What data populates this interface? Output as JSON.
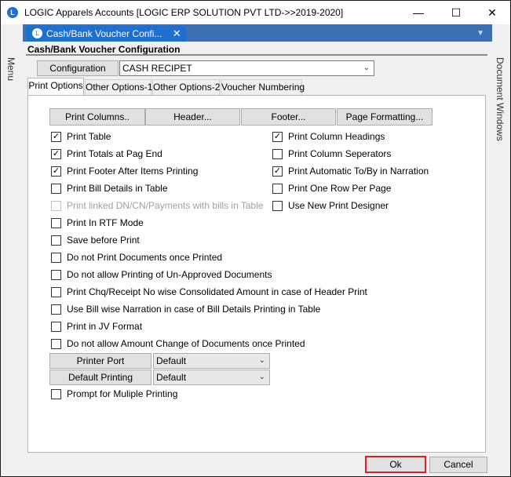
{
  "window": {
    "title": "LOGIC Apparels Accounts  [LOGIC ERP SOLUTION PVT LTD->>2019-2020]",
    "logo": "L",
    "minimize": "—",
    "maximize": "☐",
    "close": "✕"
  },
  "side": {
    "left_label": "Menu",
    "right_label": "Document Windows"
  },
  "doc_tab": {
    "label": "Cash/Bank Voucher Confi...",
    "close": "✕"
  },
  "section_title": "Cash/Bank Voucher Configuration",
  "configuration": {
    "button_label": "Configuration",
    "selected": "CASH RECIPET"
  },
  "tabs": [
    {
      "label": "Print Options",
      "active": true
    },
    {
      "label": "Other Options-1",
      "active": false
    },
    {
      "label": "Other Options-2",
      "active": false
    },
    {
      "label": "Voucher Numbering",
      "active": false
    }
  ],
  "panel_buttons": {
    "print_columns": "Print Columns..",
    "header": "Header...",
    "footer": "Footer...",
    "page_formatting": "Page Formatting..."
  },
  "left_options": [
    {
      "label": "Print Table",
      "checked": true,
      "enabled": true
    },
    {
      "label": "Print Totals at Pag End",
      "checked": true,
      "enabled": true
    },
    {
      "label": "Print Footer After Items Printing",
      "checked": true,
      "enabled": true
    },
    {
      "label": "Print Bill Details in Table",
      "checked": false,
      "enabled": true
    },
    {
      "label": "Print linked DN/CN/Payments with bills in Table",
      "checked": false,
      "enabled": false
    },
    {
      "label": "Print In RTF Mode",
      "checked": false,
      "enabled": true
    },
    {
      "label": "Save before Print",
      "checked": false,
      "enabled": true
    },
    {
      "label": "Do not Print Documents once Printed",
      "checked": false,
      "enabled": true
    },
    {
      "label": "Do not allow Printing of Un-Approved Documents",
      "checked": false,
      "enabled": true
    },
    {
      "label": "Print Chq/Receipt No wise Consolidated Amount in case of Header Print",
      "checked": false,
      "enabled": true
    },
    {
      "label": "Use Bill wise Narration in case of Bill Details Printing in Table",
      "checked": false,
      "enabled": true
    },
    {
      "label": "Print in JV Format",
      "checked": false,
      "enabled": true
    },
    {
      "label": "Do not allow Amount Change of Documents once Printed",
      "checked": false,
      "enabled": true
    }
  ],
  "right_options": [
    {
      "label": "Print Column Headings",
      "checked": true
    },
    {
      "label": "Print Column Seperators",
      "checked": false
    },
    {
      "label": "Print Automatic To/By in Narration",
      "checked": true
    },
    {
      "label": "Print One Row Per Page",
      "checked": false
    },
    {
      "label": "Use New Print Designer",
      "checked": false
    }
  ],
  "printer_port": {
    "label": "Printer Port",
    "value": "Default"
  },
  "default_printing": {
    "label": "Default Printing",
    "value": "Default"
  },
  "prompt_option": {
    "label": "Prompt for Muliple Printing",
    "checked": false
  },
  "footer_buttons": {
    "ok": "Ok",
    "cancel": "Cancel"
  },
  "glyphs": {
    "check": "✓",
    "dropdown": "⌄"
  },
  "colors": {
    "accent": "#1f6fd1",
    "tabbar": "#3d6fb3",
    "ok_border": "#d81f26"
  }
}
